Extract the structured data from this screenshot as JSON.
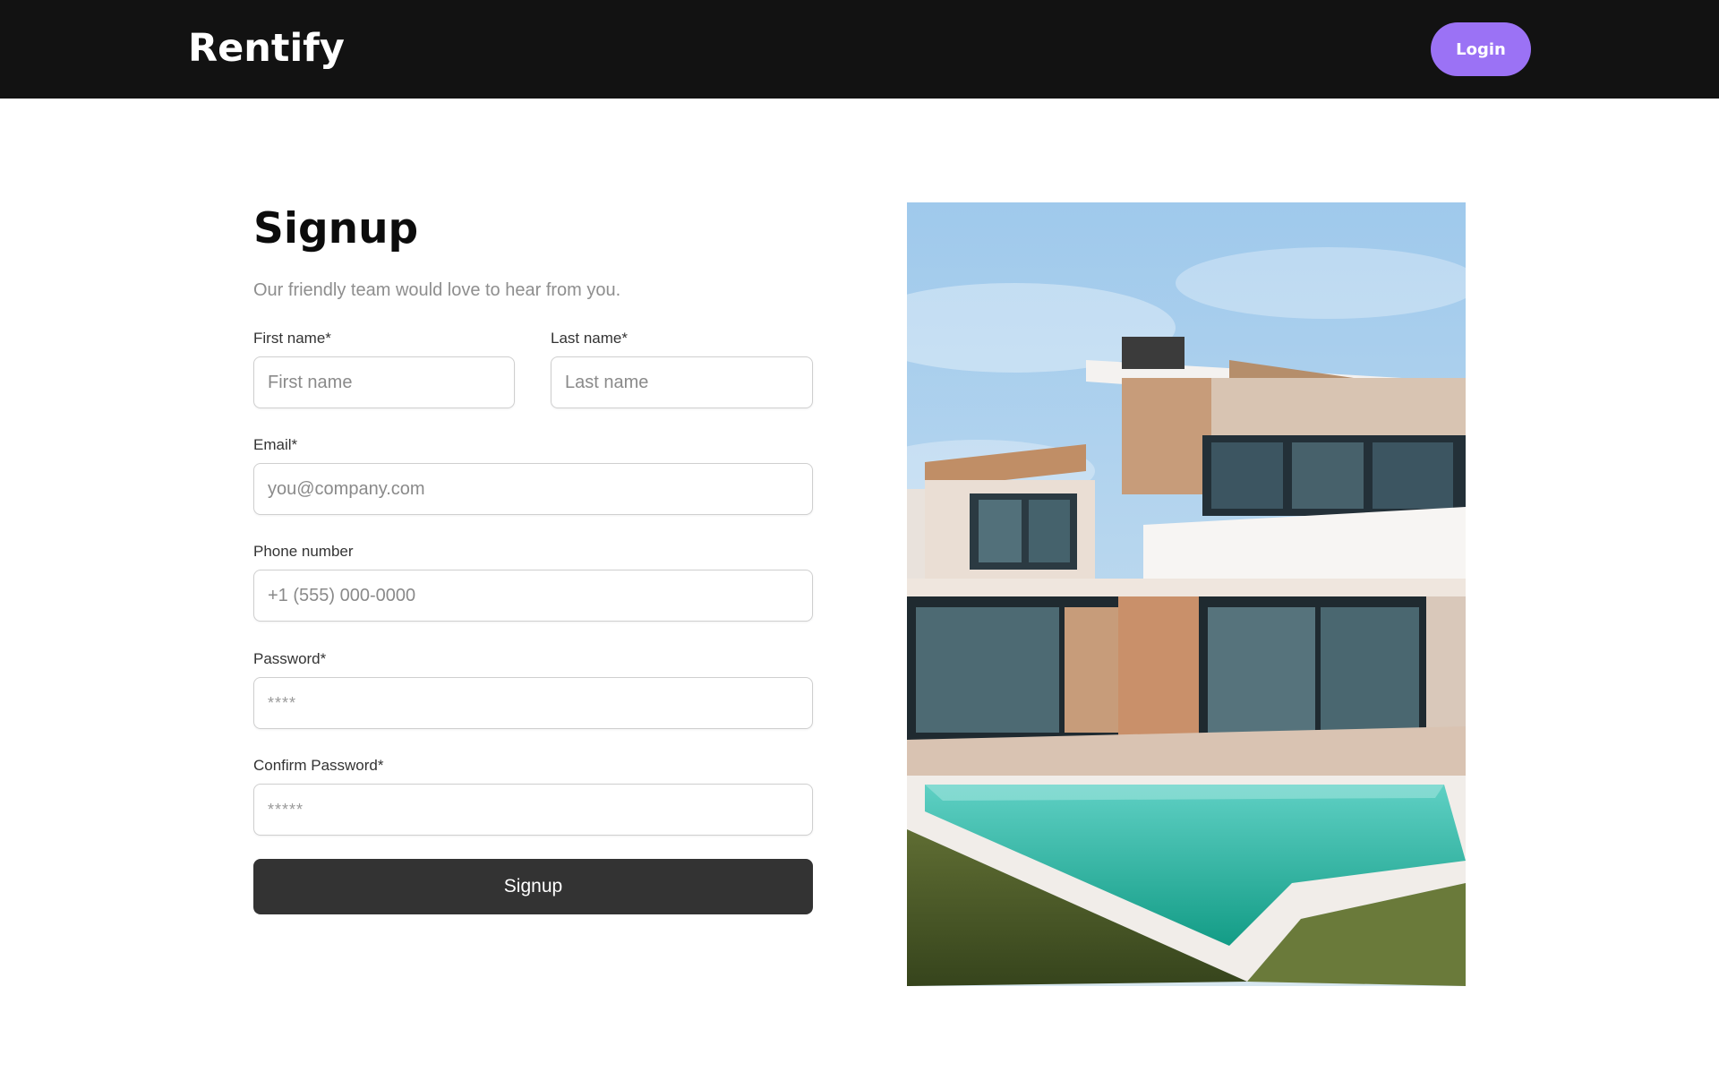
{
  "navbar": {
    "brand": "Rentify",
    "login_label": "Login"
  },
  "form": {
    "title": "Signup",
    "subtitle": "Our friendly team would love to hear from you.",
    "fields": {
      "first_name": {
        "label": "First name*",
        "placeholder": "First name"
      },
      "last_name": {
        "label": "Last name*",
        "placeholder": "Last name"
      },
      "email": {
        "label": "Email*",
        "placeholder": "you@company.com"
      },
      "phone": {
        "label": "Phone number",
        "placeholder": "+1 (555) 000-0000"
      },
      "password": {
        "label": "Password*",
        "placeholder": "****"
      },
      "confirm_password": {
        "label": "Confirm Password*",
        "placeholder": "*****"
      }
    },
    "submit_label": "Signup"
  },
  "colors": {
    "navbar_bg": "#121212",
    "accent": "#9b72f5",
    "button_dark": "#333333"
  }
}
